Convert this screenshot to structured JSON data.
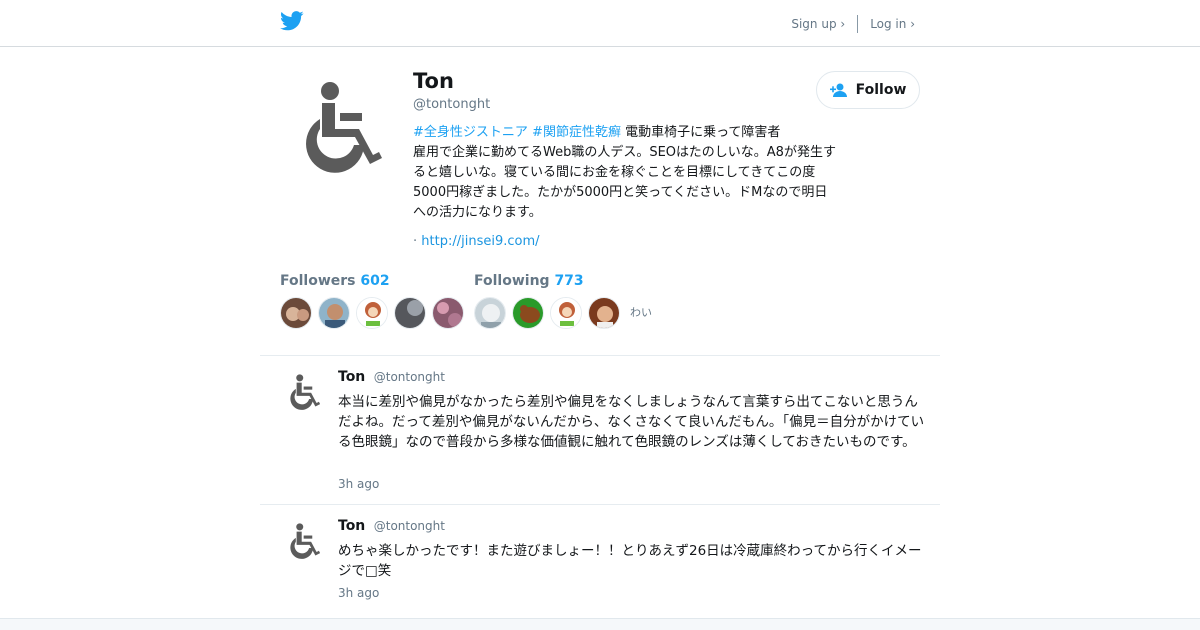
{
  "nav": {
    "signup_label": "Sign up ›",
    "login_label": "Log in ›"
  },
  "colors": {
    "accent": "#1da1f2",
    "text": "#14171a",
    "muted": "#657786"
  },
  "profile": {
    "name": "Ton",
    "handle": "@tontonght",
    "avatar_icon": "wheelchair-icon",
    "follow_label": "Follow",
    "bio_tag1": "#全身性ジストニア",
    "bio_tag2": "#関節症性乾癬",
    "bio_line1": " 電動車椅子に乗って障害者",
    "bio_rest": "雇用で企業に勤めてるWeb職の人デス。SEOはたのしいな。A8が発生すると嬉しいな。寝ている間にお金を稼ぐことを目標にしてきてこの度5000円稼ぎました。たかが5000円と笑ってください。ドMなので明日への活力になります。",
    "url_prefix": "·",
    "url": "http://jinsei9.com/"
  },
  "stats": {
    "followers_label": "Followers",
    "followers_count": "602",
    "following_label": "Following",
    "following_count": "773",
    "following_extra_text": "わい"
  },
  "tweets": [
    {
      "name": "Ton",
      "handle": "@tontonght",
      "text": "本当に差別や偏見がなかったら差別や偏見をなくしましょうなんて言葉すら出てこないと思うんだよね。だって差別や偏見がないんだから、なくさなくて良いんだもん。「偏見＝自分がかけている色眼鏡」なので普段から多様な価値観に触れて色眼鏡のレンズは薄くしておきたいものです。",
      "time": "3h ago"
    },
    {
      "name": "Ton",
      "handle": "@tontonght",
      "text": "めちゃ楽しかったです！また遊びましょー！！とりあえず26日は冷蔵庫終わってから行くイメージで□笑",
      "time": "3h ago"
    }
  ]
}
